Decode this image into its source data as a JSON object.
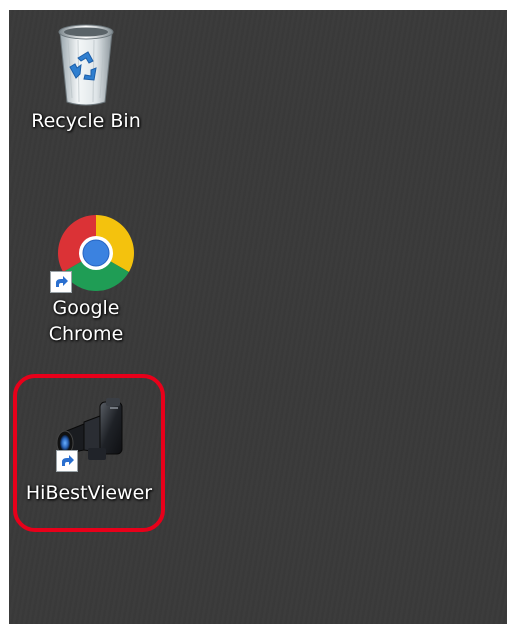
{
  "desktop": {
    "background_color": "#3a3a3a",
    "icons": [
      {
        "label": "Recycle Bin",
        "icon": "recycle-bin-icon",
        "shortcut": false
      },
      {
        "label": "Google\nChrome",
        "icon": "chrome-icon",
        "shortcut": true
      },
      {
        "label": "HiBestViewer",
        "icon": "camera-icon",
        "shortcut": true,
        "highlighted": true
      }
    ]
  },
  "highlight_color": "#e8001a"
}
